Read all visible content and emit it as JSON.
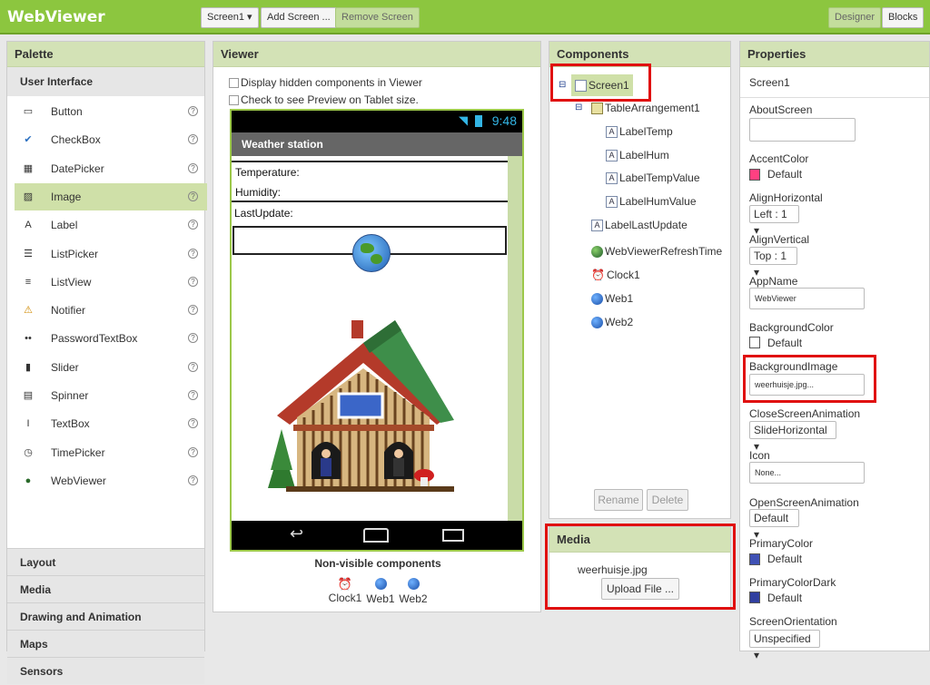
{
  "app": {
    "title": "WebViewer"
  },
  "toolbar": {
    "screen_select": "Screen1 ▾",
    "add_screen": "Add Screen ...",
    "remove_screen": "Remove Screen",
    "designer": "Designer",
    "blocks": "Blocks"
  },
  "palette": {
    "title": "Palette",
    "section_open": "User Interface",
    "items": [
      {
        "label": "Button",
        "icon": "button-icon"
      },
      {
        "label": "CheckBox",
        "icon": "checkbox-icon"
      },
      {
        "label": "DatePicker",
        "icon": "datepicker-icon"
      },
      {
        "label": "Image",
        "icon": "image-icon"
      },
      {
        "label": "Label",
        "icon": "label-icon"
      },
      {
        "label": "ListPicker",
        "icon": "listpicker-icon"
      },
      {
        "label": "ListView",
        "icon": "listview-icon"
      },
      {
        "label": "Notifier",
        "icon": "notifier-icon"
      },
      {
        "label": "PasswordTextBox",
        "icon": "passwordtextbox-icon"
      },
      {
        "label": "Slider",
        "icon": "slider-icon"
      },
      {
        "label": "Spinner",
        "icon": "spinner-icon"
      },
      {
        "label": "TextBox",
        "icon": "textbox-icon"
      },
      {
        "label": "TimePicker",
        "icon": "timepicker-icon"
      },
      {
        "label": "WebViewer",
        "icon": "webviewer-icon"
      }
    ],
    "help_glyph": "?",
    "sections": [
      "Layout",
      "Media",
      "Drawing and Animation",
      "Maps",
      "Sensors"
    ]
  },
  "viewer": {
    "title": "Viewer",
    "check_hidden": "Display hidden components in Viewer",
    "check_tablet": "Check to see Preview on Tablet size.",
    "status_time": "9:48",
    "app_title": "Weather station",
    "label_temp": "Temperature:",
    "label_hum": "Humidity:",
    "label_last_update": "LastUpdate:",
    "nonvisible_title": "Non-visible components",
    "nonvisible": [
      "Clock1",
      "Web1",
      "Web2"
    ]
  },
  "components": {
    "title": "Components",
    "tree": [
      {
        "label": "Screen1"
      },
      {
        "label": "TableArrangement1"
      },
      {
        "label": "LabelTemp"
      },
      {
        "label": "LabelHum"
      },
      {
        "label": "LabelTempValue"
      },
      {
        "label": "LabelHumValue"
      },
      {
        "label": "LabelLastUpdate"
      },
      {
        "label": "WebViewerRefreshTime"
      },
      {
        "label": "Clock1"
      },
      {
        "label": "Web1"
      },
      {
        "label": "Web2"
      }
    ],
    "collapse_glyph": "⊟",
    "label_icon_glyph": "A",
    "rename": "Rename",
    "delete": "Delete"
  },
  "media": {
    "title": "Media",
    "file": "weerhuisje.jpg",
    "upload": "Upload File ..."
  },
  "properties": {
    "title": "Properties",
    "screen": "Screen1",
    "about_screen": "AboutScreen",
    "accent_color": "AccentColor",
    "accent_value": "Default",
    "align_horizontal": "AlignHorizontal",
    "align_horizontal_value": "Left : 1 ▾",
    "align_vertical": "AlignVertical",
    "align_vertical_value": "Top : 1 ▾",
    "app_name": "AppName",
    "app_name_value": "WebViewer",
    "background_color": "BackgroundColor",
    "background_color_value": "Default",
    "background_image": "BackgroundImage",
    "background_image_value": "weerhuisje.jpg...",
    "close_anim": "CloseScreenAnimation",
    "close_anim_value": "SlideHorizontal ▾",
    "icon": "Icon",
    "icon_value": "None...",
    "open_anim": "OpenScreenAnimation",
    "open_anim_value": "Default ▾",
    "primary_color": "PrimaryColor",
    "primary_color_value": "Default",
    "primary_dark": "PrimaryColorDark",
    "primary_dark_value": "Default",
    "orientation": "ScreenOrientation",
    "orientation_value": "Unspecified ▾"
  },
  "colors": {
    "accent": "#ff4081",
    "primary": "#3f51b5",
    "primary_dark": "#303f9f",
    "topbar": "#8cc63f",
    "highlight": "#e01010"
  }
}
